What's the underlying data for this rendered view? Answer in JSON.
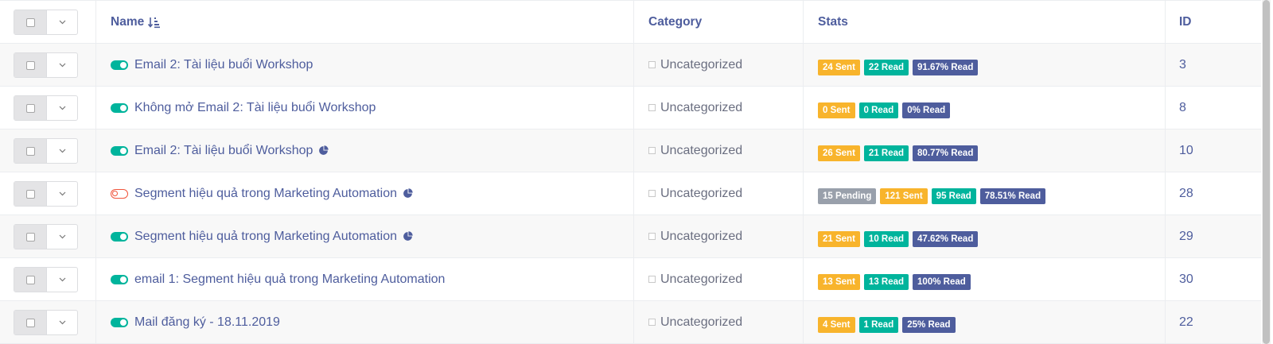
{
  "header": {
    "name_label": "Name",
    "category_label": "Category",
    "stats_label": "Stats",
    "id_label": "ID"
  },
  "colors": {
    "pending": "#99a0ab",
    "sent": "#f8b42c",
    "read": "#00b49c",
    "read_pct": "#4e5d9d",
    "toggle_on": "#00b49c",
    "toggle_off": "#f0553c"
  },
  "rows": [
    {
      "name": "Email 2: Tài liệu buổi Workshop",
      "enabled": true,
      "has_segment_icon": false,
      "category": "Uncategorized",
      "stats": [
        {
          "type": "sent",
          "label": "24 Sent"
        },
        {
          "type": "read",
          "label": "22 Read"
        },
        {
          "type": "read_pct",
          "label": "91.67% Read"
        }
      ],
      "id": "3"
    },
    {
      "name": "Không mở Email 2: Tài liệu buổi Workshop",
      "enabled": true,
      "has_segment_icon": false,
      "category": "Uncategorized",
      "stats": [
        {
          "type": "sent",
          "label": "0 Sent"
        },
        {
          "type": "read",
          "label": "0 Read"
        },
        {
          "type": "read_pct",
          "label": "0% Read"
        }
      ],
      "id": "8"
    },
    {
      "name": "Email 2: Tài liệu buổi Workshop",
      "enabled": true,
      "has_segment_icon": true,
      "category": "Uncategorized",
      "stats": [
        {
          "type": "sent",
          "label": "26 Sent"
        },
        {
          "type": "read",
          "label": "21 Read"
        },
        {
          "type": "read_pct",
          "label": "80.77% Read"
        }
      ],
      "id": "10"
    },
    {
      "name": "Segment hiệu quả trong Marketing Automation",
      "enabled": false,
      "has_segment_icon": true,
      "category": "Uncategorized",
      "stats": [
        {
          "type": "pending",
          "label": "15 Pending"
        },
        {
          "type": "sent",
          "label": "121 Sent"
        },
        {
          "type": "read",
          "label": "95 Read"
        },
        {
          "type": "read_pct",
          "label": "78.51% Read"
        }
      ],
      "id": "28"
    },
    {
      "name": "Segment hiệu quả trong Marketing Automation",
      "enabled": true,
      "has_segment_icon": true,
      "category": "Uncategorized",
      "stats": [
        {
          "type": "sent",
          "label": "21 Sent"
        },
        {
          "type": "read",
          "label": "10 Read"
        },
        {
          "type": "read_pct",
          "label": "47.62% Read"
        }
      ],
      "id": "29"
    },
    {
      "name": "email 1: Segment hiệu quả trong Marketing Automation",
      "enabled": true,
      "has_segment_icon": false,
      "category": "Uncategorized",
      "stats": [
        {
          "type": "sent",
          "label": "13 Sent"
        },
        {
          "type": "read",
          "label": "13 Read"
        },
        {
          "type": "read_pct",
          "label": "100% Read"
        }
      ],
      "id": "30"
    },
    {
      "name": "Mail đăng ký - 18.11.2019",
      "enabled": true,
      "has_segment_icon": false,
      "category": "Uncategorized",
      "stats": [
        {
          "type": "sent",
          "label": "4 Sent"
        },
        {
          "type": "read",
          "label": "1 Read"
        },
        {
          "type": "read_pct",
          "label": "25% Read"
        }
      ],
      "id": "22"
    }
  ]
}
